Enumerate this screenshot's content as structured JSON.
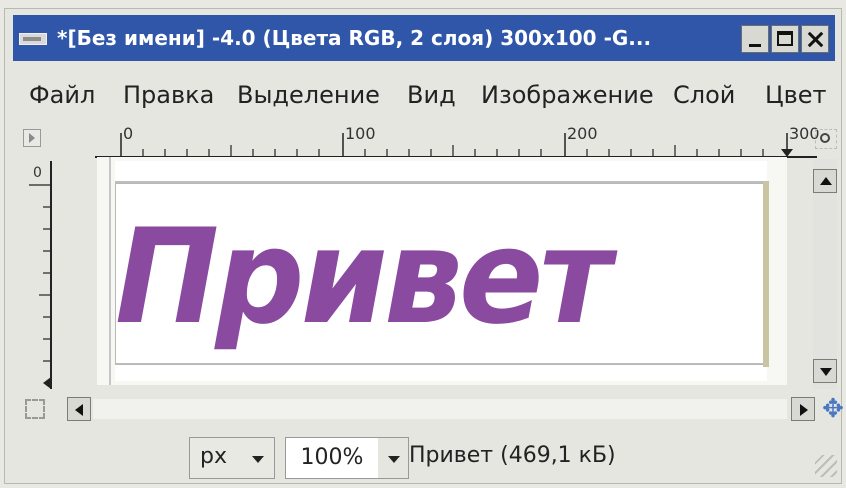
{
  "window": {
    "title": "*[Без имени] -4.0 (Цвета RGB, 2 слоя) 300x100 -G..."
  },
  "menu": {
    "items": [
      "Файл",
      "Правка",
      "Выделение",
      "Вид",
      "Изображение",
      "Слой",
      "Цвет"
    ]
  },
  "rulers": {
    "horizontal_labels": [
      "0",
      "100",
      "200",
      "300"
    ],
    "vertical_label": "0"
  },
  "canvas": {
    "text": "Привет",
    "text_color": "#8a4a9f"
  },
  "status": {
    "unit": "px",
    "zoom": "100%",
    "info": "Привет (469,1 кБ)"
  },
  "icons": {
    "app": "gimp-icon",
    "navigate": "navigate-icon",
    "zoom": "zoom-icon",
    "quickmask": "quick-mask-icon",
    "move": "move-icon"
  }
}
